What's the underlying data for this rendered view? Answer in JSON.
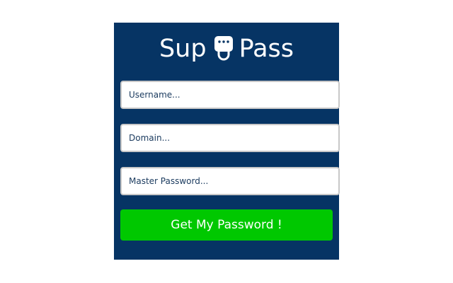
{
  "app": {
    "title_left": "Sup",
    "title_right": "Pass",
    "logo_icon": "plug-face-icon"
  },
  "form": {
    "username_placeholder": "Username...",
    "domain_placeholder": "Domain...",
    "password_placeholder": "Master Password...",
    "submit_label": "Get My Password !"
  },
  "colors": {
    "panel": "#063464",
    "button": "#00c800"
  }
}
